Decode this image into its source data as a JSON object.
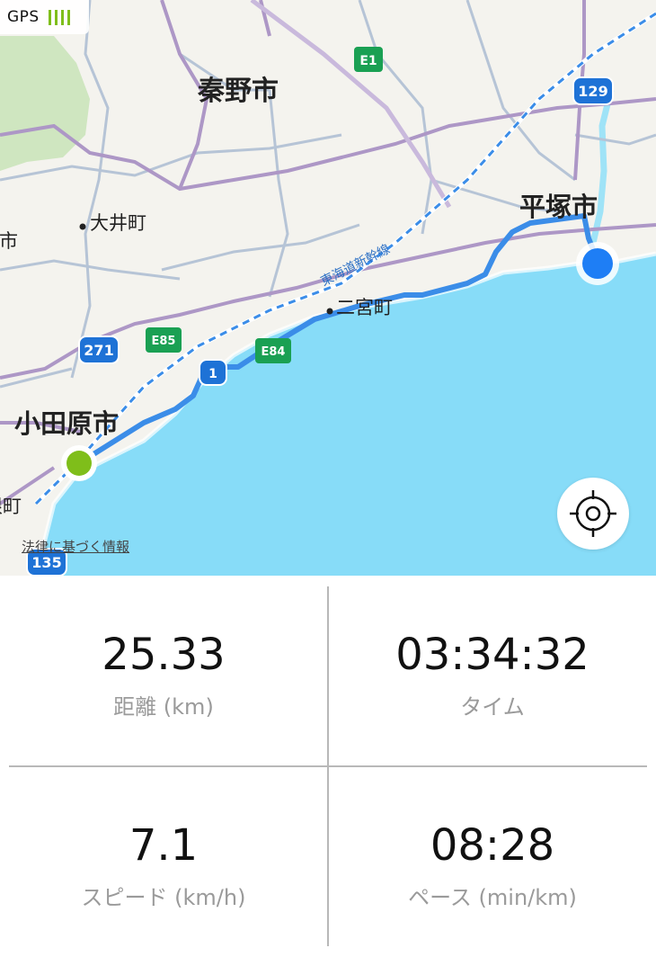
{
  "gps": {
    "label": "GPS",
    "signal_bars": 4,
    "signal_color": "#7fbe1a"
  },
  "map": {
    "cities": {
      "hadano": "秦野市",
      "hiratsuka": "平塚市",
      "odawara": "小田原市"
    },
    "towns": {
      "oi": "大井町",
      "ninomiya": "二宮町",
      "left_cut": "南市",
      "hakone_cut": "根町"
    },
    "rail_label": "東海道新幹線",
    "routes": {
      "r129": "129",
      "r271": "271",
      "r135": "135",
      "r1": "1"
    },
    "expressways": {
      "e1": "E1",
      "e85": "E85",
      "e84": "E84"
    },
    "legal_link": "法律に基づく情報",
    "colors": {
      "sea": "#87dcf8",
      "land": "#f4f3ee",
      "route": "#3b8de8",
      "start": "#7fbe1a",
      "end": "#1e7ef5"
    }
  },
  "stats": {
    "distance": {
      "value": "25.33",
      "label": "距離 (km)"
    },
    "time": {
      "value": "03:34:32",
      "label": "タイム"
    },
    "speed": {
      "value": "7.1",
      "label": "スピード (km/h)"
    },
    "pace": {
      "value": "08:28",
      "label": "ペース (min/km)"
    }
  }
}
